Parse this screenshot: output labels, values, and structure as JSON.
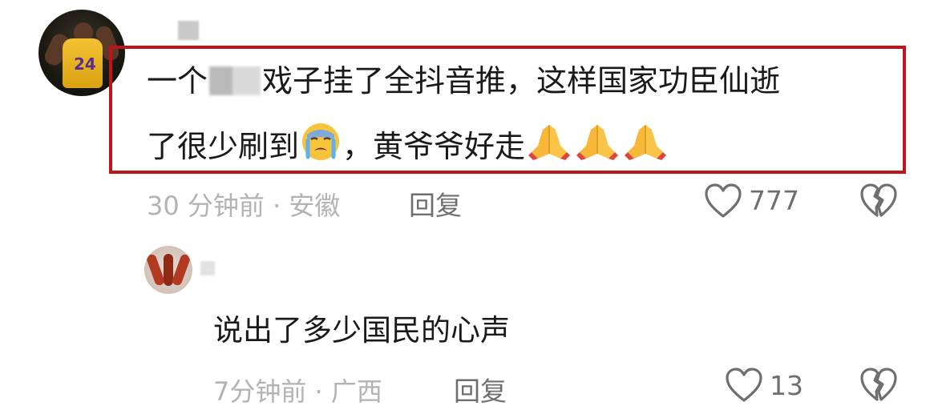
{
  "comment": {
    "text_part1": "一个",
    "text_part2": "戏子挂了全抖音推，这样国家功臣仙逝",
    "text_line2": "了很少刷到",
    "text_after_emoji": "，黄爷爷好走",
    "emojis": [
      "crying-face-emoji",
      "folded-hands-emoji",
      "folded-hands-emoji",
      "folded-hands-emoji"
    ],
    "time_location": "30 分钟前 · 安徽",
    "reply_label": "回复",
    "like_count": "777",
    "highlight_color": "#c0141c"
  },
  "reply": {
    "text": "说出了多少国民的心声",
    "time_location": "7分钟前 · 广西",
    "reply_label": "回复",
    "like_count": "13"
  }
}
